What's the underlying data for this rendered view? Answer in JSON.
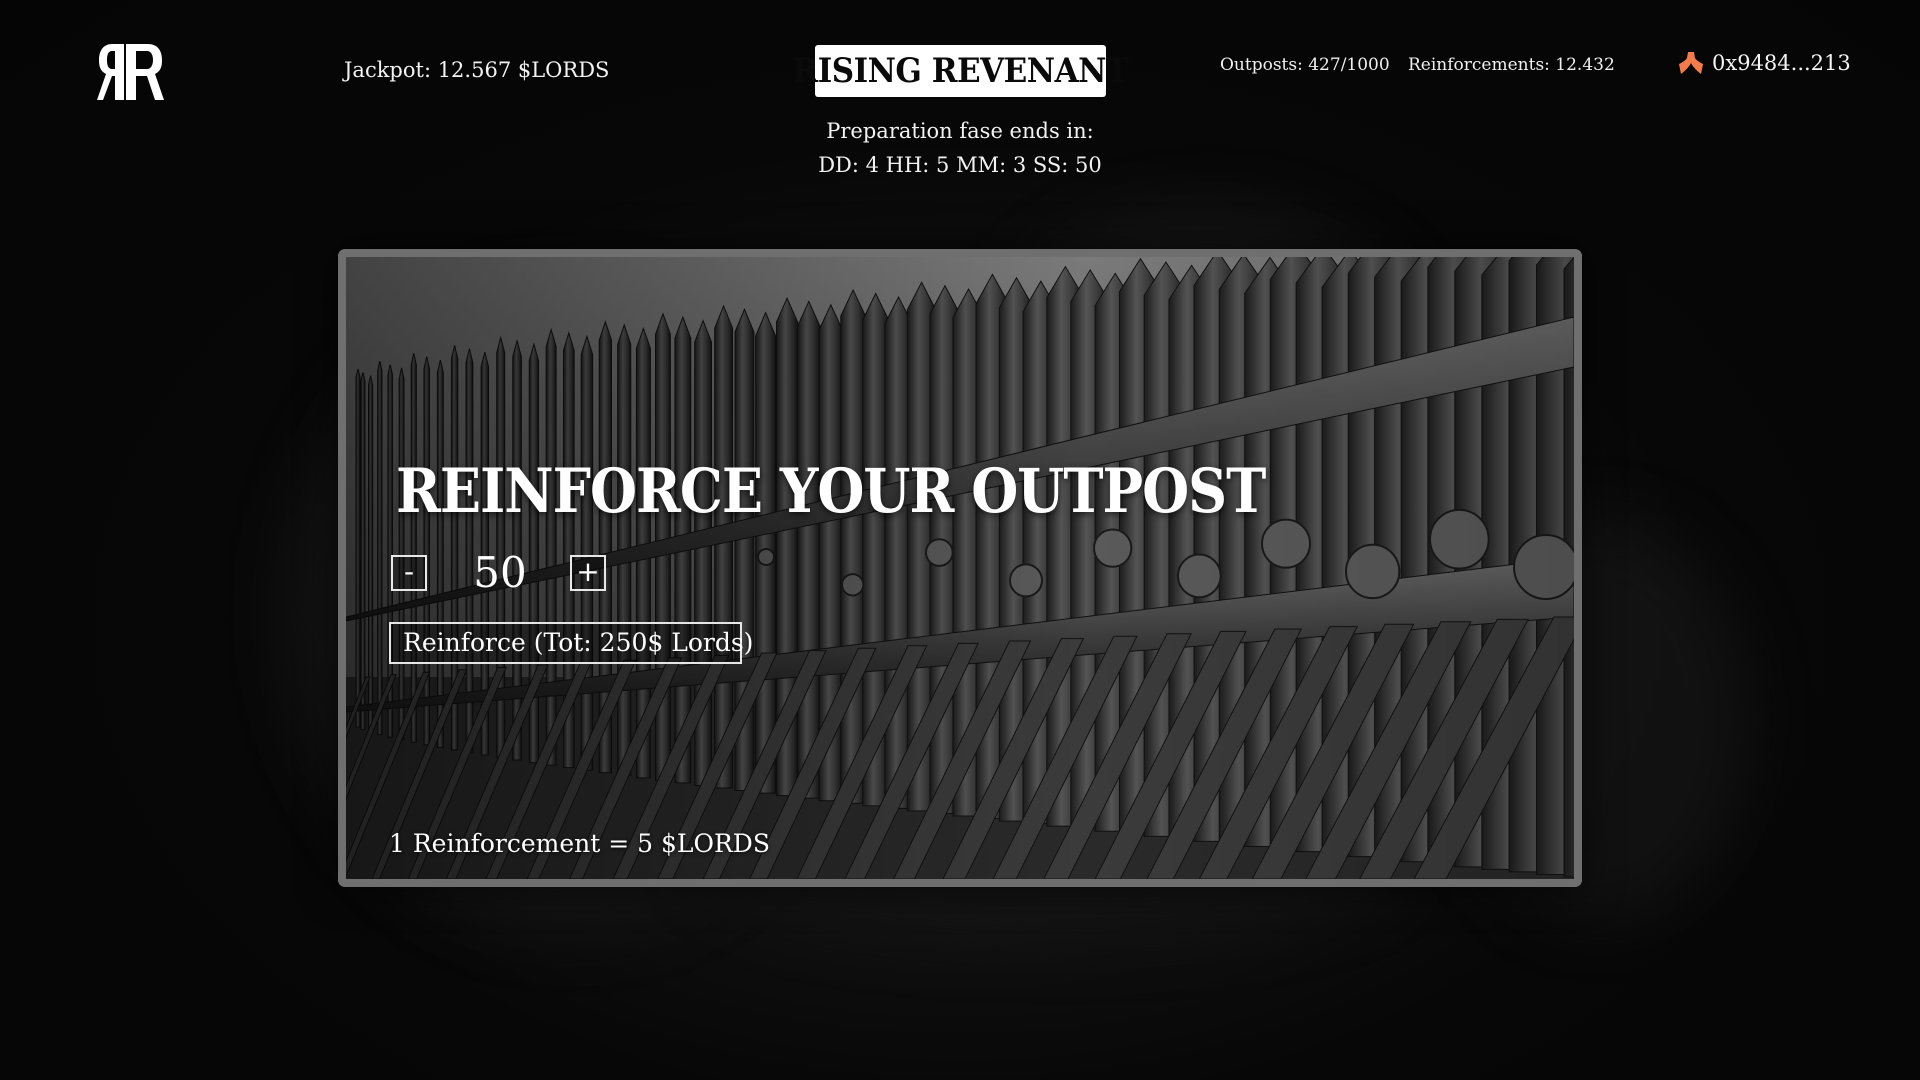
{
  "header": {
    "logo_icon": "rr-monogram-icon",
    "jackpot": "Jackpot: 12.567 $LORDS",
    "title": "RISING REVENANT",
    "outposts": "Outposts: 427/1000",
    "reinforcements": "Reinforcements: 12.432",
    "wallet_icon": "argent-wallet-icon",
    "wallet_address": "0x9484...213"
  },
  "timer": {
    "label": "Preparation fase ends in:",
    "value": "DD: 4 HH: 5 MM: 3 SS: 50"
  },
  "panel": {
    "background": "palisade-wall-illustration",
    "title": "REINFORCE YOUR OUTPOST",
    "minus_label": "-",
    "plus_label": "+",
    "quantity": "50",
    "reinforce_button": "Reinforce (Tot: 250$ Lords)",
    "rate_text": "1 Reinforcement = 5 $LORDS"
  },
  "colors": {
    "background": "#060606",
    "panel_border": "#6f6f6f",
    "wallet_accent": "#f47c4a",
    "text": "#f2f2f2"
  }
}
